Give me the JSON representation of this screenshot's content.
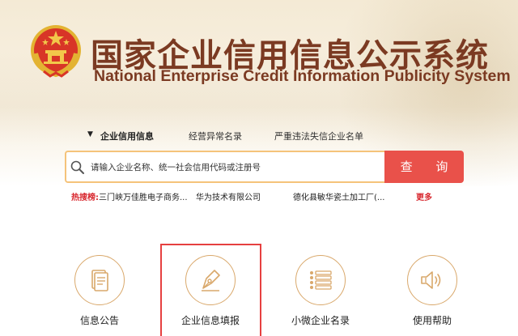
{
  "header": {
    "title_cn": "国家企业信用信息公示系统",
    "title_en": "National Enterprise Credit Information Publicity System"
  },
  "tabs": [
    {
      "label": "企业信用信息",
      "active": true
    },
    {
      "label": "经营异常名录",
      "active": false
    },
    {
      "label": "严重违法失信企业名单",
      "active": false
    }
  ],
  "search": {
    "placeholder": "请输入企业名称、统一社会信用代码或注册号",
    "button_label": "查 询"
  },
  "hot_search": {
    "label": "热搜榜:",
    "items": [
      "三门峡万佳胜电子商务...",
      "华为技术有限公司",
      "德化县敏华瓷土加工厂(..."
    ],
    "more_label": "更多"
  },
  "services": [
    {
      "label": "信息公告",
      "icon": "document-icon"
    },
    {
      "label": "企业信息填报",
      "icon": "pen-icon"
    },
    {
      "label": "小微企业名录",
      "icon": "list-icon"
    },
    {
      "label": "使用帮助",
      "icon": "speaker-icon"
    }
  ],
  "colors": {
    "brand": "#7b3a22",
    "accent_red": "#e9514a",
    "icon_gold": "#d9a86b",
    "search_border": "#f5c37a"
  }
}
